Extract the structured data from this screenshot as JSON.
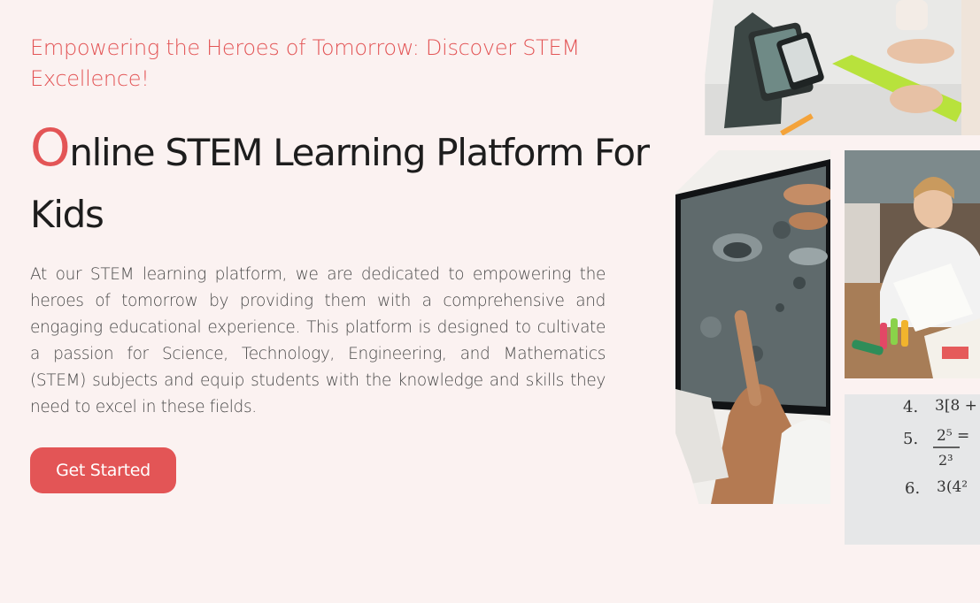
{
  "hero": {
    "tagline": "Empowering the Heroes of Tomorrow: Discover STEM Excellence!",
    "heading_first_letter": "O",
    "heading_rest": "nline STEM Learning Platform For Kids",
    "description": "At our STEM learning platform, we are dedicated to empowering the heroes of tomorrow by providing them with a comprehensive and engaging educational experience. This platform is designed to cultivate a passion for Science, Technology, Engineering, and Mathematics (STEM) subjects and equip students with the knowledge and skills they need to excel in these fields.",
    "cta_label": "Get Started"
  },
  "collage": {
    "images": [
      {
        "name": "kids-tablet-photo"
      },
      {
        "name": "moon-tablet-photo"
      },
      {
        "name": "boy-writing-photo"
      },
      {
        "name": "math-whiteboard-photo"
      }
    ],
    "math_lines": [
      {
        "number": "4.",
        "expr": "3[8 +"
      },
      {
        "number": "5.",
        "expr": "2⁵ ="
      },
      {
        "number": "",
        "expr": "2³"
      },
      {
        "number": "6.",
        "expr": "3(4²"
      }
    ]
  },
  "colors": {
    "accent": "#e35556",
    "background": "#fbf2f1",
    "heading": "#1d1d1d",
    "body_text": "#4a4a4a"
  }
}
